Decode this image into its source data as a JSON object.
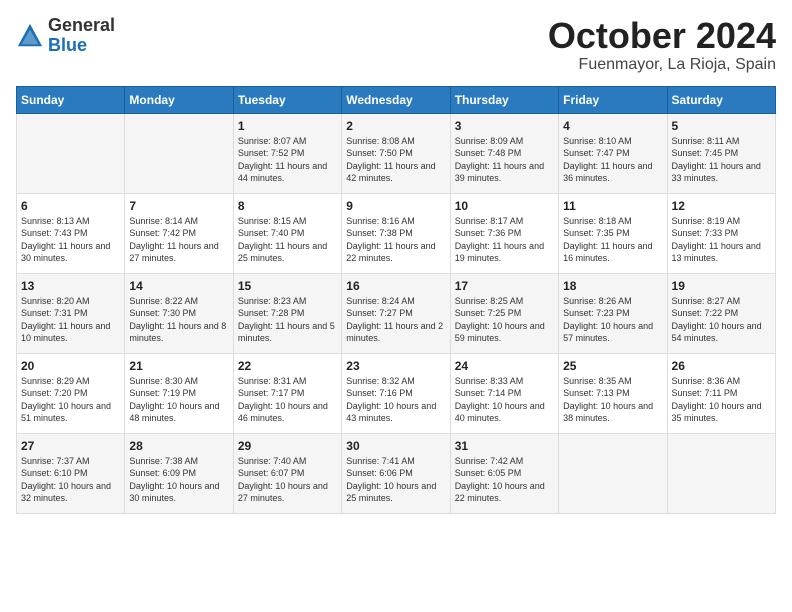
{
  "header": {
    "logo_general": "General",
    "logo_blue": "Blue",
    "month_title": "October 2024",
    "location": "Fuenmayor, La Rioja, Spain"
  },
  "weekdays": [
    "Sunday",
    "Monday",
    "Tuesday",
    "Wednesday",
    "Thursday",
    "Friday",
    "Saturday"
  ],
  "weeks": [
    [
      {
        "day": "",
        "info": ""
      },
      {
        "day": "",
        "info": ""
      },
      {
        "day": "1",
        "info": "Sunrise: 8:07 AM\nSunset: 7:52 PM\nDaylight: 11 hours and 44 minutes."
      },
      {
        "day": "2",
        "info": "Sunrise: 8:08 AM\nSunset: 7:50 PM\nDaylight: 11 hours and 42 minutes."
      },
      {
        "day": "3",
        "info": "Sunrise: 8:09 AM\nSunset: 7:48 PM\nDaylight: 11 hours and 39 minutes."
      },
      {
        "day": "4",
        "info": "Sunrise: 8:10 AM\nSunset: 7:47 PM\nDaylight: 11 hours and 36 minutes."
      },
      {
        "day": "5",
        "info": "Sunrise: 8:11 AM\nSunset: 7:45 PM\nDaylight: 11 hours and 33 minutes."
      }
    ],
    [
      {
        "day": "6",
        "info": "Sunrise: 8:13 AM\nSunset: 7:43 PM\nDaylight: 11 hours and 30 minutes."
      },
      {
        "day": "7",
        "info": "Sunrise: 8:14 AM\nSunset: 7:42 PM\nDaylight: 11 hours and 27 minutes."
      },
      {
        "day": "8",
        "info": "Sunrise: 8:15 AM\nSunset: 7:40 PM\nDaylight: 11 hours and 25 minutes."
      },
      {
        "day": "9",
        "info": "Sunrise: 8:16 AM\nSunset: 7:38 PM\nDaylight: 11 hours and 22 minutes."
      },
      {
        "day": "10",
        "info": "Sunrise: 8:17 AM\nSunset: 7:36 PM\nDaylight: 11 hours and 19 minutes."
      },
      {
        "day": "11",
        "info": "Sunrise: 8:18 AM\nSunset: 7:35 PM\nDaylight: 11 hours and 16 minutes."
      },
      {
        "day": "12",
        "info": "Sunrise: 8:19 AM\nSunset: 7:33 PM\nDaylight: 11 hours and 13 minutes."
      }
    ],
    [
      {
        "day": "13",
        "info": "Sunrise: 8:20 AM\nSunset: 7:31 PM\nDaylight: 11 hours and 10 minutes."
      },
      {
        "day": "14",
        "info": "Sunrise: 8:22 AM\nSunset: 7:30 PM\nDaylight: 11 hours and 8 minutes."
      },
      {
        "day": "15",
        "info": "Sunrise: 8:23 AM\nSunset: 7:28 PM\nDaylight: 11 hours and 5 minutes."
      },
      {
        "day": "16",
        "info": "Sunrise: 8:24 AM\nSunset: 7:27 PM\nDaylight: 11 hours and 2 minutes."
      },
      {
        "day": "17",
        "info": "Sunrise: 8:25 AM\nSunset: 7:25 PM\nDaylight: 10 hours and 59 minutes."
      },
      {
        "day": "18",
        "info": "Sunrise: 8:26 AM\nSunset: 7:23 PM\nDaylight: 10 hours and 57 minutes."
      },
      {
        "day": "19",
        "info": "Sunrise: 8:27 AM\nSunset: 7:22 PM\nDaylight: 10 hours and 54 minutes."
      }
    ],
    [
      {
        "day": "20",
        "info": "Sunrise: 8:29 AM\nSunset: 7:20 PM\nDaylight: 10 hours and 51 minutes."
      },
      {
        "day": "21",
        "info": "Sunrise: 8:30 AM\nSunset: 7:19 PM\nDaylight: 10 hours and 48 minutes."
      },
      {
        "day": "22",
        "info": "Sunrise: 8:31 AM\nSunset: 7:17 PM\nDaylight: 10 hours and 46 minutes."
      },
      {
        "day": "23",
        "info": "Sunrise: 8:32 AM\nSunset: 7:16 PM\nDaylight: 10 hours and 43 minutes."
      },
      {
        "day": "24",
        "info": "Sunrise: 8:33 AM\nSunset: 7:14 PM\nDaylight: 10 hours and 40 minutes."
      },
      {
        "day": "25",
        "info": "Sunrise: 8:35 AM\nSunset: 7:13 PM\nDaylight: 10 hours and 38 minutes."
      },
      {
        "day": "26",
        "info": "Sunrise: 8:36 AM\nSunset: 7:11 PM\nDaylight: 10 hours and 35 minutes."
      }
    ],
    [
      {
        "day": "27",
        "info": "Sunrise: 7:37 AM\nSunset: 6:10 PM\nDaylight: 10 hours and 32 minutes."
      },
      {
        "day": "28",
        "info": "Sunrise: 7:38 AM\nSunset: 6:09 PM\nDaylight: 10 hours and 30 minutes."
      },
      {
        "day": "29",
        "info": "Sunrise: 7:40 AM\nSunset: 6:07 PM\nDaylight: 10 hours and 27 minutes."
      },
      {
        "day": "30",
        "info": "Sunrise: 7:41 AM\nSunset: 6:06 PM\nDaylight: 10 hours and 25 minutes."
      },
      {
        "day": "31",
        "info": "Sunrise: 7:42 AM\nSunset: 6:05 PM\nDaylight: 10 hours and 22 minutes."
      },
      {
        "day": "",
        "info": ""
      },
      {
        "day": "",
        "info": ""
      }
    ]
  ]
}
